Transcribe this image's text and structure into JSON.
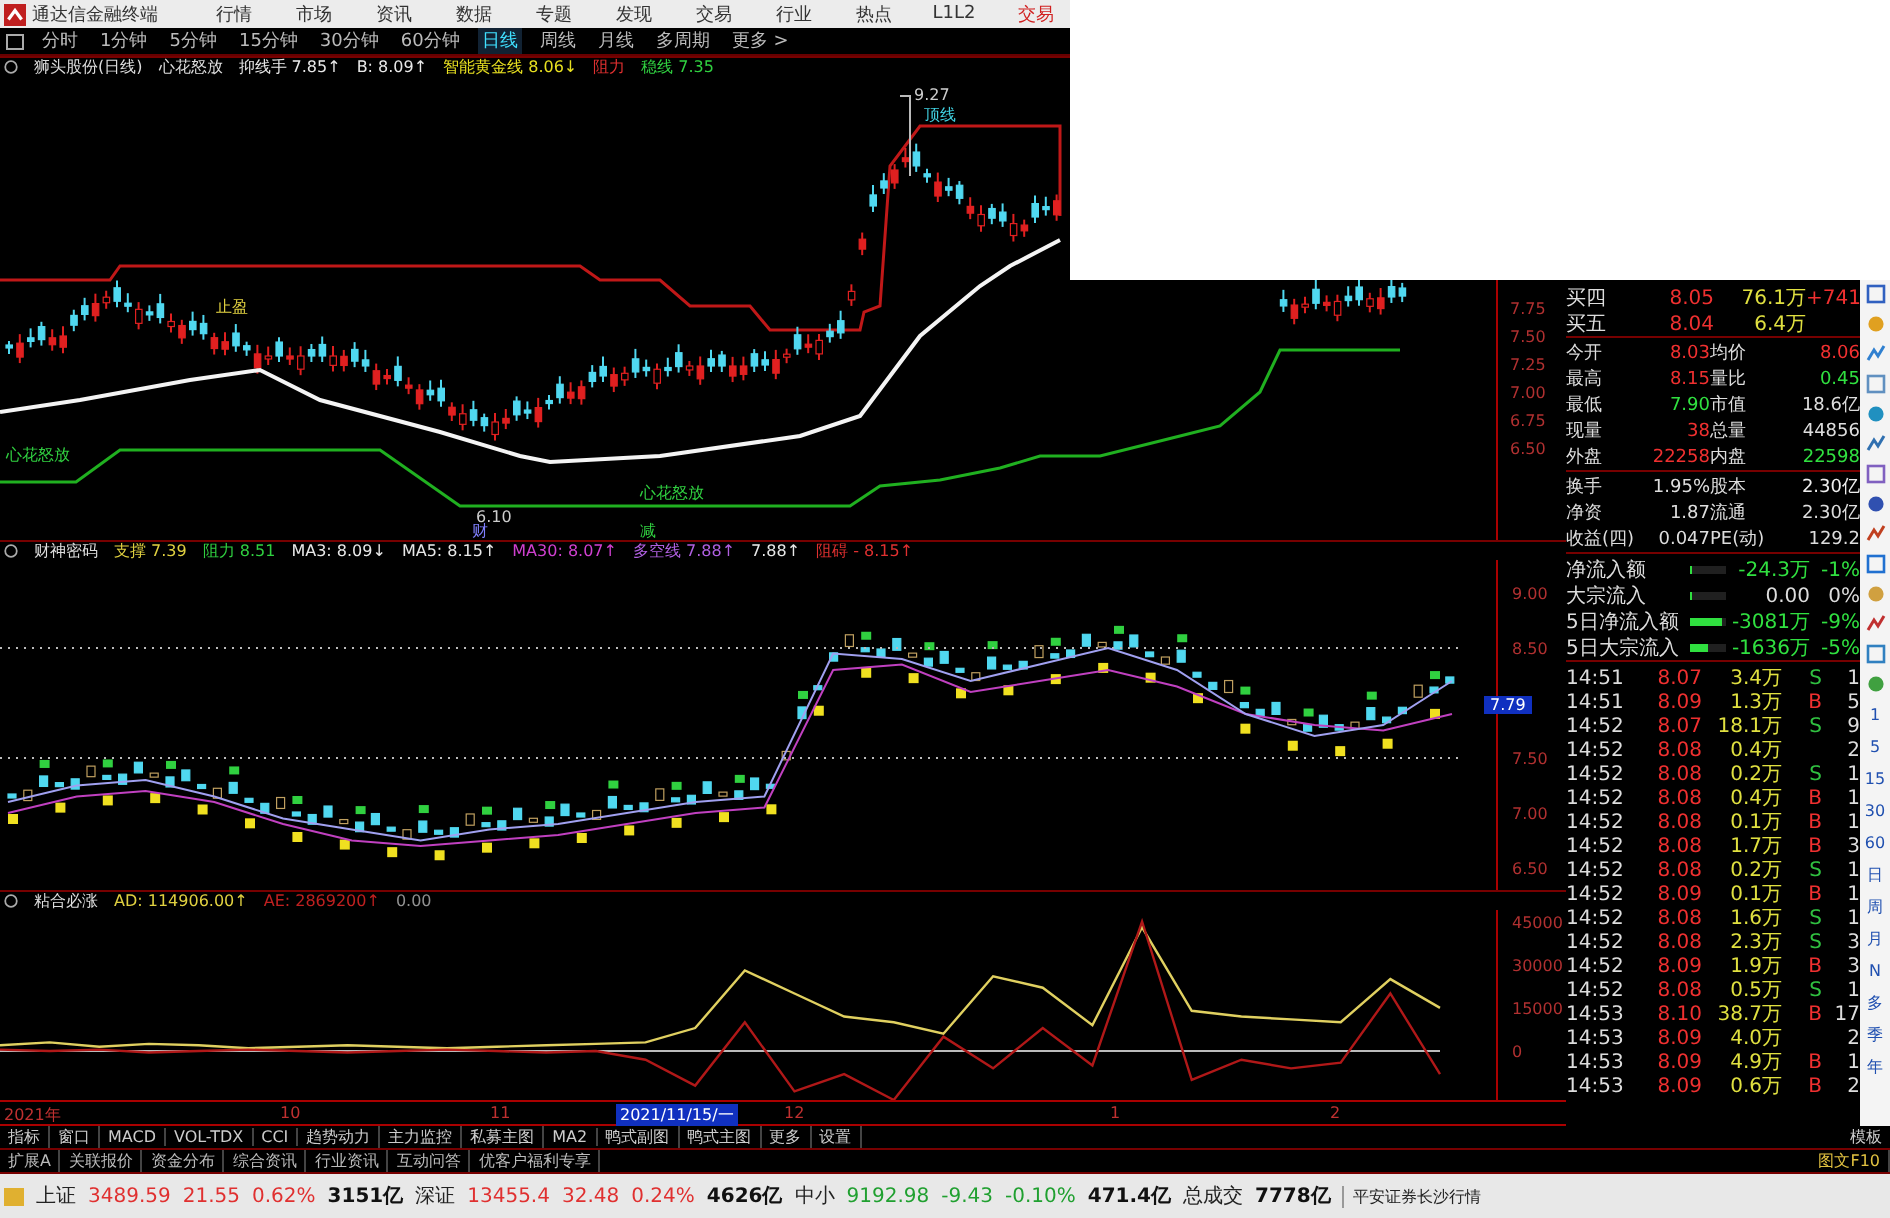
{
  "menubar": {
    "app_title": "通达信金融终端",
    "items": [
      "行情",
      "市场",
      "资讯",
      "数据",
      "专题",
      "发现",
      "交易",
      "行业",
      "热点",
      "L1L2"
    ],
    "trade": "交易"
  },
  "periods": [
    {
      "label": "分时",
      "selected": false
    },
    {
      "label": "1分钟",
      "selected": false
    },
    {
      "label": "5分钟",
      "selected": false
    },
    {
      "label": "15分钟",
      "selected": false
    },
    {
      "label": "30分钟",
      "selected": false
    },
    {
      "label": "60分钟",
      "selected": false
    },
    {
      "label": "日线",
      "selected": true
    },
    {
      "label": "周线",
      "selected": false
    },
    {
      "label": "月线",
      "selected": false
    },
    {
      "label": "多周期",
      "selected": false
    },
    {
      "label": "更多 >",
      "selected": false
    }
  ],
  "main_chart": {
    "stock": "狮头股份(日线)",
    "indicator": "心花怒放",
    "values": [
      {
        "text": "抑线手 7.85↑",
        "color": "#e8e8e8"
      },
      {
        "text": "B: 8.09↑",
        "color": "#e8e8e8"
      },
      {
        "text": "智能黄金线 8.06↓",
        "color": "#e8e020"
      },
      {
        "text": "阻力",
        "color": "#e03030"
      },
      {
        "text": "稳线 7.35",
        "color": "#30d040"
      }
    ],
    "labels": [
      "9.27",
      "顶线",
      "止盈",
      "心花怒放",
      "心花怒放",
      "6.10",
      "财",
      "减"
    ],
    "axis": [
      "7.75",
      "7.50",
      "7.25",
      "7.00",
      "6.75",
      "6.50"
    ]
  },
  "panel_2": {
    "indicator": "财神密码",
    "values": [
      {
        "text": "支撑 7.39",
        "color": "#e0d040"
      },
      {
        "text": "阻力 8.51",
        "color": "#30d040"
      },
      {
        "text": "MA3: 8.09↓",
        "color": "#e8e8e8"
      },
      {
        "text": "MA5: 8.15↑",
        "color": "#e8e8e8"
      },
      {
        "text": "MA30: 8.07↑",
        "color": "#d040d0"
      },
      {
        "text": "多空线 7.88↑",
        "color": "#b060e0"
      },
      {
        "text": "7.88↑",
        "color": "#e8e8e8"
      },
      {
        "text": "阻碍 - 8.15↑",
        "color": "#e03030"
      }
    ],
    "current": "7.79",
    "chart_data": {
      "type": "line",
      "ylim": [
        6.3,
        9.3
      ],
      "yticks": [
        {
          "value": 9.0,
          "label": "9.00"
        },
        {
          "value": 8.5,
          "label": "8.50"
        },
        {
          "value": 7.5,
          "label": "7.50"
        },
        {
          "value": 7.0,
          "label": "7.00"
        },
        {
          "value": 6.5,
          "label": "6.50"
        }
      ],
      "series": [
        {
          "color": "#c040c0",
          "values": [
            7.0,
            7.15,
            7.2,
            7.1,
            6.9,
            6.75,
            6.7,
            6.75,
            6.8,
            6.9,
            7.0,
            7.05,
            8.3,
            8.35,
            8.1,
            8.2,
            8.3,
            8.15,
            7.9,
            7.8,
            7.75,
            7.9
          ]
        },
        {
          "color": "#a0a0f0",
          "values": [
            7.1,
            7.25,
            7.3,
            7.15,
            6.95,
            6.85,
            6.75,
            6.85,
            6.9,
            7.0,
            7.1,
            7.15,
            8.45,
            8.4,
            8.2,
            8.35,
            8.5,
            8.3,
            7.9,
            7.7,
            7.8,
            8.2
          ]
        }
      ]
    }
  },
  "panel_3": {
    "indicator": "粘合必涨",
    "values": [
      {
        "text": "AD: 114906.00↑",
        "color": "#e0d040"
      },
      {
        "text": "AE: 2869200↑",
        "color": "#c02020"
      },
      {
        "text": "0.00",
        "color": "#909090"
      }
    ],
    "chart_data": {
      "type": "line",
      "ylim": [
        -17000,
        49000
      ],
      "yticks": [
        45000,
        30000,
        15000,
        0
      ],
      "series": [
        {
          "color": "#e0d060",
          "values": [
            2000,
            3000,
            1500,
            2500,
            2000,
            1000,
            1500,
            2000,
            1500,
            1000,
            1500,
            2000,
            2500,
            3000,
            8000,
            28000,
            20000,
            12000,
            10000,
            6000,
            26000,
            22000,
            9000,
            43000,
            14000,
            12000,
            11000,
            10000,
            25000,
            15000
          ]
        },
        {
          "color": "#b01818",
          "values": [
            500,
            0,
            500,
            -500,
            0,
            500,
            0,
            -500,
            0,
            500,
            0,
            -500,
            0,
            -3000,
            -12000,
            10000,
            -14000,
            -8000,
            -17000,
            5000,
            -6000,
            8000,
            -5000,
            45000,
            -10000,
            -3000,
            -6000,
            -4000,
            20000,
            -8000
          ]
        }
      ]
    }
  },
  "date_axis": [
    {
      "text": "2021年",
      "kind": "tick"
    },
    {
      "text": "10",
      "kind": "tick"
    },
    {
      "text": "11",
      "kind": "tick"
    },
    {
      "text": "2021/11/15/一",
      "kind": "cursor"
    },
    {
      "text": "12",
      "kind": "tick"
    },
    {
      "text": "1",
      "kind": "tick"
    },
    {
      "text": "2",
      "kind": "tick"
    }
  ],
  "quote": {
    "bids": [
      {
        "label": "买四",
        "price": "8.05",
        "volume": "76.1万",
        "change": "+741"
      },
      {
        "label": "买五",
        "price": "8.04",
        "volume": "6.4万"
      }
    ],
    "stats": [
      [
        {
          "label": "今开",
          "value": "8.03",
          "color": "#f03030"
        },
        {
          "label": "均价",
          "value": "8.06",
          "color": "#f03030"
        }
      ],
      [
        {
          "label": "最高",
          "value": "8.15",
          "color": "#f03030"
        },
        {
          "label": "量比",
          "value": "0.45",
          "color": "#30e040"
        }
      ],
      [
        {
          "label": "最低",
          "value": "7.90",
          "color": "#30e040"
        },
        {
          "label": "市值",
          "value": "18.6亿",
          "color": "#dddddd"
        }
      ],
      [
        {
          "label": "现量",
          "value": "38",
          "color": "#f03030"
        },
        {
          "label": "总量",
          "value": "44856",
          "color": "#dddddd"
        }
      ],
      [
        {
          "label": "外盘",
          "value": "22258",
          "color": "#f03030"
        },
        {
          "label": "内盘",
          "value": "22598",
          "color": "#30e040"
        }
      ],
      [
        {
          "label": "换手",
          "value": "1.95%",
          "color": "#dddddd"
        },
        {
          "label": "股本",
          "value": "2.30亿",
          "color": "#eeeeee"
        }
      ],
      [
        {
          "label": "净资",
          "value": "1.87",
          "color": "#dddddd"
        },
        {
          "label": "流通",
          "value": "2.30亿",
          "color": "#dddddd"
        }
      ],
      [
        {
          "label": "收益(四)",
          "value": "0.047",
          "color": "#dddddd"
        },
        {
          "label": "PE(动)",
          "value": "129.2",
          "color": "#dddddd"
        }
      ]
    ],
    "flows": [
      {
        "label": "净流入额",
        "level": 0.05,
        "value": "-24.3万",
        "pct": "-1%",
        "color": "#30e040"
      },
      {
        "label": "大宗流入",
        "level": 0.05,
        "value": "0.00",
        "pct": "0%",
        "color": "#dddddd"
      },
      {
        "label": "5日净流入额",
        "level": 0.9,
        "value": "-3081万",
        "pct": "-9%",
        "color": "#30e040"
      },
      {
        "label": "5日大宗流入",
        "level": 0.5,
        "value": "-1636万",
        "pct": "-5%",
        "color": "#30e040"
      }
    ],
    "ticks": [
      {
        "time": "14:51",
        "price": "8.07",
        "volume": "3.4万",
        "side": "S",
        "color": "#30c040",
        "count": "1"
      },
      {
        "time": "14:51",
        "price": "8.09",
        "volume": "1.3万",
        "side": "B",
        "color": "#f03030",
        "count": "5"
      },
      {
        "time": "14:52",
        "price": "8.07",
        "volume": "18.1万",
        "side": "S",
        "color": "#30c040",
        "count": "9"
      },
      {
        "time": "14:52",
        "price": "8.08",
        "volume": "0.4万",
        "count": "2"
      },
      {
        "time": "14:52",
        "price": "8.08",
        "volume": "0.2万",
        "side": "S",
        "color": "#30c040",
        "count": "1"
      },
      {
        "time": "14:52",
        "price": "8.08",
        "volume": "0.4万",
        "side": "B",
        "color": "#f03030",
        "count": "1"
      },
      {
        "time": "14:52",
        "price": "8.08",
        "volume": "0.1万",
        "side": "B",
        "color": "#f03030",
        "count": "1"
      },
      {
        "time": "14:52",
        "price": "8.08",
        "volume": "1.7万",
        "side": "B",
        "color": "#f03030",
        "count": "3"
      },
      {
        "time": "14:52",
        "price": "8.08",
        "volume": "0.2万",
        "side": "S",
        "color": "#30c040",
        "count": "1"
      },
      {
        "time": "14:52",
        "price": "8.09",
        "volume": "0.1万",
        "side": "B",
        "color": "#f03030",
        "count": "1"
      },
      {
        "time": "14:52",
        "price": "8.08",
        "volume": "1.6万",
        "side": "S",
        "color": "#30c040",
        "count": "1"
      },
      {
        "time": "14:52",
        "price": "8.08",
        "volume": "2.3万",
        "side": "S",
        "color": "#30c040",
        "count": "3"
      },
      {
        "time": "14:52",
        "price": "8.09",
        "volume": "1.9万",
        "side": "B",
        "color": "#f03030",
        "count": "3"
      },
      {
        "time": "14:52",
        "price": "8.08",
        "volume": "0.5万",
        "side": "S",
        "color": "#30c040",
        "count": "1"
      },
      {
        "time": "14:53",
        "price": "8.10",
        "volume": "38.7万",
        "side": "B",
        "color": "#f03030",
        "count": "17"
      },
      {
        "time": "14:53",
        "price": "8.09",
        "volume": "4.0万",
        "count": "2"
      },
      {
        "time": "14:53",
        "price": "8.09",
        "volume": "4.9万",
        "side": "B",
        "color": "#f03030",
        "count": "1"
      },
      {
        "time": "14:53",
        "price": "8.09",
        "volume": "0.6万",
        "side": "B",
        "color": "#f03030",
        "count": "2"
      }
    ]
  },
  "side_periods": [
    "1",
    "5",
    "15",
    "30",
    "60",
    "日",
    "周",
    "月",
    "N",
    "多",
    "季",
    "年"
  ],
  "indicator_tabs": [
    "指标",
    "窗口",
    "MACD",
    "VOL-TDX",
    "CCI",
    "趋势动力",
    "主力监控",
    "私募主图",
    "MA2",
    "鸭式副图",
    "鸭式主图",
    "更多",
    "设置"
  ],
  "template": "模板",
  "ext_tabs": [
    "扩展A",
    "关联报价",
    "资金分布",
    "综合资讯",
    "行业资讯",
    "互动问答",
    "优客户福利专享"
  ],
  "f10": "图文F10",
  "status": {
    "indices": [
      {
        "name": "上证",
        "value": "3489.59",
        "change": "21.55",
        "pct": "0.62%",
        "amount": "3151亿",
        "color": "#e03030"
      },
      {
        "name": "深证",
        "value": "13455.4",
        "change": "32.48",
        "pct": "0.24%",
        "amount": "4626亿",
        "color": "#e03030"
      },
      {
        "name": "中小",
        "value": "9192.98",
        "change": "-9.43",
        "pct": "-0.10%",
        "amount": "471.4亿",
        "color": "#20a030"
      }
    ],
    "total_label": "总成交",
    "total": "7778亿",
    "broker": "平安证券长沙行情"
  }
}
